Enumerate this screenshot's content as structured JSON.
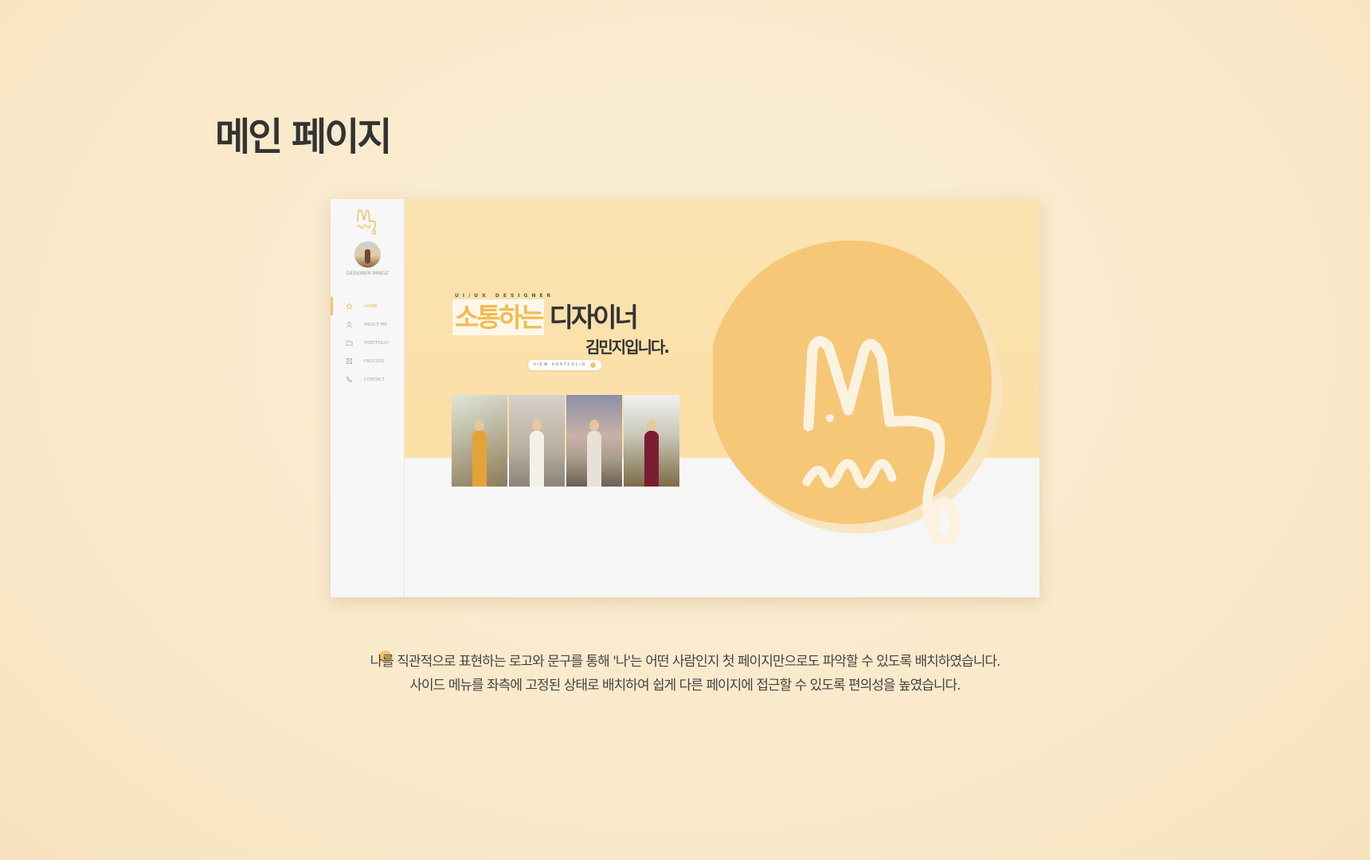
{
  "page": {
    "heading": "메인 페이지"
  },
  "sidebar": {
    "logo_icon": "logo-mj-icon",
    "designer_name": "DESIGNER MINGZ",
    "nav": [
      {
        "label": "HOME",
        "icon": "home-icon",
        "active": true
      },
      {
        "label": "ABOUT ME",
        "icon": "user-icon",
        "active": false
      },
      {
        "label": "PORTFOLIO",
        "icon": "folder-icon",
        "active": false
      },
      {
        "label": "PROCESS",
        "icon": "process-icon",
        "active": false
      },
      {
        "label": "CONTACT",
        "icon": "phone-icon",
        "active": false
      }
    ]
  },
  "hero": {
    "eyebrow": "UI/UX DESIGNER",
    "highlight": "소통하는",
    "headline_rest": "디자이너",
    "headline2": "김민지입니다.",
    "button_label": "VIEW PORTFOLIO"
  },
  "caption": {
    "line1": "나를 직관적으로 표현하는 로고와 문구를 통해 '나'는 어떤 사람인지 첫 페이지만으로도 파악할 수 있도록 배치하였습니다.",
    "line2": "사이드 메뉴를 좌측에 고정된 상태로 배치하여 쉽게 다른 페이지에 접근할 수 있도록 편의성을 높였습니다."
  },
  "colors": {
    "accent": "#f4c36c",
    "hero_bg": "#fbe3b0",
    "page_bg": "#faecd0"
  }
}
